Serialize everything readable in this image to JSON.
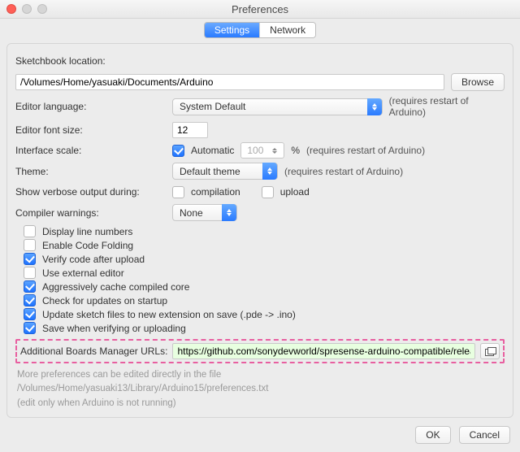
{
  "window": {
    "title": "Preferences"
  },
  "tabs": {
    "settings": "Settings",
    "network": "Network"
  },
  "sketchbook": {
    "label": "Sketchbook location:",
    "path": "/Volumes/Home/yasuaki/Documents/Arduino",
    "browse": "Browse"
  },
  "editorLanguage": {
    "label": "Editor language:",
    "value": "System Default",
    "note": "(requires restart of Arduino)"
  },
  "editorFontSize": {
    "label": "Editor font size:",
    "value": "12"
  },
  "interfaceScale": {
    "label": "Interface scale:",
    "autoLabel": "Automatic",
    "autoChecked": true,
    "value": "100",
    "percent": "%",
    "note": "(requires restart of Arduino)"
  },
  "theme": {
    "label": "Theme:",
    "value": "Default theme",
    "note": "(requires restart of Arduino)"
  },
  "verbose": {
    "label": "Show verbose output during:",
    "compilation": {
      "label": "compilation",
      "checked": false
    },
    "upload": {
      "label": "upload",
      "checked": false
    }
  },
  "compilerWarnings": {
    "label": "Compiler warnings:",
    "value": "None"
  },
  "options": [
    {
      "label": "Display line numbers",
      "checked": false
    },
    {
      "label": "Enable Code Folding",
      "checked": false
    },
    {
      "label": "Verify code after upload",
      "checked": true
    },
    {
      "label": "Use external editor",
      "checked": false
    },
    {
      "label": "Aggressively cache compiled core",
      "checked": true
    },
    {
      "label": "Check for updates on startup",
      "checked": true
    },
    {
      "label": "Update sketch files to new extension on save (.pde -> .ino)",
      "checked": true
    },
    {
      "label": "Save when verifying or uploading",
      "checked": true
    }
  ],
  "boardsUrls": {
    "label": "Additional Boards Manager URLs:",
    "value": "https://github.com/sonydevworld/spresense-arduino-compatible/releases/d"
  },
  "footer": {
    "line1": "More preferences can be edited directly in the file",
    "line2": "/Volumes/Home/yasuaki13/Library/Arduino15/preferences.txt",
    "line3": "(edit only when Arduino is not running)"
  },
  "buttons": {
    "ok": "OK",
    "cancel": "Cancel"
  }
}
